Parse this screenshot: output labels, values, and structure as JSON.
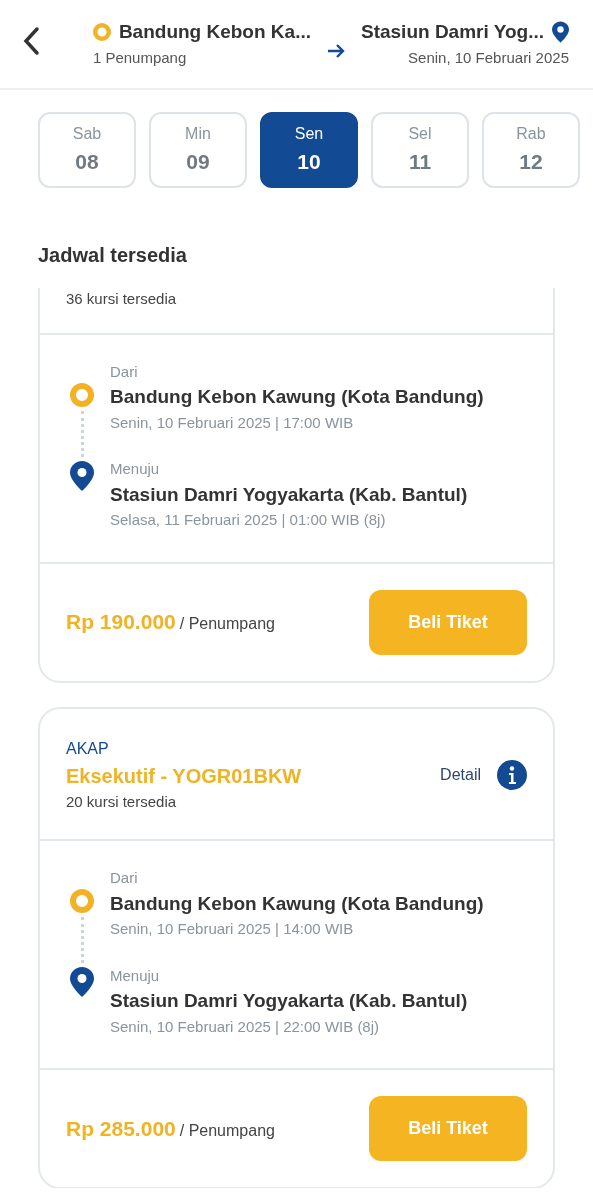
{
  "header": {
    "origin": "Bandung Kebon Ka...",
    "passengers": "1 Penumpang",
    "destination": "Stasiun Damri Yog...",
    "date": "Senin, 10 Februari 2025"
  },
  "dates": [
    {
      "day": "Sab",
      "num": "08",
      "selected": false
    },
    {
      "day": "Min",
      "num": "09",
      "selected": false
    },
    {
      "day": "Sen",
      "num": "10",
      "selected": true
    },
    {
      "day": "Sel",
      "num": "11",
      "selected": false
    },
    {
      "day": "Rab",
      "num": "12",
      "selected": false
    }
  ],
  "section_title": "Jadwal tersedia",
  "schedules": [
    {
      "cut_top": true,
      "seats": "36 kursi tersedia",
      "from_label": "Dari",
      "from": "Bandung Kebon Kawung (Kota Bandung)",
      "from_time": "Senin, 10 Februari 2025 | 17:00 WIB",
      "to_label": "Menuju",
      "to": "Stasiun Damri Yogyakarta (Kab. Bantul)",
      "to_time": "Selasa, 11 Februari 2025 | 01:00 WIB (8j)",
      "price": "Rp 190.000",
      "per": "/ Penumpang",
      "button": "Beli Tiket"
    },
    {
      "cut_top": false,
      "type": "AKAP",
      "class": "Eksekutif - YOGR01BKW",
      "seats": "20 kursi tersedia",
      "detail": "Detail",
      "from_label": "Dari",
      "from": "Bandung Kebon Kawung (Kota Bandung)",
      "from_time": "Senin, 10 Februari 2025 | 14:00 WIB",
      "to_label": "Menuju",
      "to": "Stasiun Damri Yogyakarta (Kab. Bantul)",
      "to_time": "Senin, 10 Februari 2025 | 22:00 WIB (8j)",
      "price": "Rp 285.000",
      "per": "/ Penumpang",
      "button": "Beli Tiket"
    }
  ]
}
